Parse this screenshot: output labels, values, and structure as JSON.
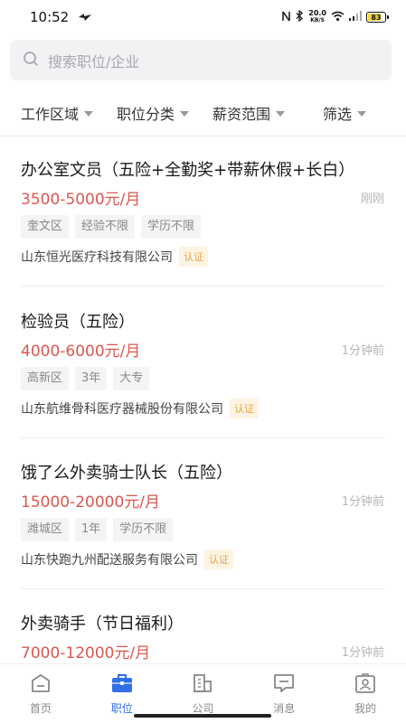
{
  "status_bar": {
    "time": "10:52",
    "net_speed_value": "20.0",
    "net_speed_unit": "KB/S",
    "battery": "83",
    "battery_level": 0.83
  },
  "search": {
    "placeholder": "搜索职位/企业"
  },
  "filters": [
    {
      "label": "工作区域"
    },
    {
      "label": "职位分类"
    },
    {
      "label": "薪资范围"
    },
    {
      "label": "筛选"
    }
  ],
  "jobs": [
    {
      "title": "办公室文员（五险+全勤奖+带薪休假+长白）",
      "salary": "3500-5000元/月",
      "time": "刚刚",
      "tags": [
        "奎文区",
        "经验不限",
        "学历不限"
      ],
      "company": "山东恒光医疗科技有限公司",
      "badge": "认证"
    },
    {
      "title": "检验员（五险）",
      "salary": "4000-6000元/月",
      "time": "1分钟前",
      "tags": [
        "高新区",
        "3年",
        "大专"
      ],
      "company": "山东航维骨科医疗器械股份有限公司",
      "badge": "认证"
    },
    {
      "title": "饿了么外卖骑士队长（五险）",
      "salary": "15000-20000元/月",
      "time": "1分钟前",
      "tags": [
        "潍城区",
        "1年",
        "学历不限"
      ],
      "company": "山东快跑九州配送服务有限公司",
      "badge": "认证"
    },
    {
      "title": "外卖骑手（节日福利）",
      "salary": "7000-12000元/月",
      "time": "1分钟前",
      "tags": [],
      "company": "",
      "badge": ""
    }
  ],
  "tabs": [
    {
      "label": "首页",
      "icon": "home-icon"
    },
    {
      "label": "职位",
      "icon": "briefcase-icon"
    },
    {
      "label": "公司",
      "icon": "building-icon"
    },
    {
      "label": "消息",
      "icon": "message-icon"
    },
    {
      "label": "我的",
      "icon": "profile-icon"
    }
  ],
  "colors": {
    "accent": "#2f6fe8",
    "salary": "#d9574f",
    "badge": "#e2a64a"
  }
}
